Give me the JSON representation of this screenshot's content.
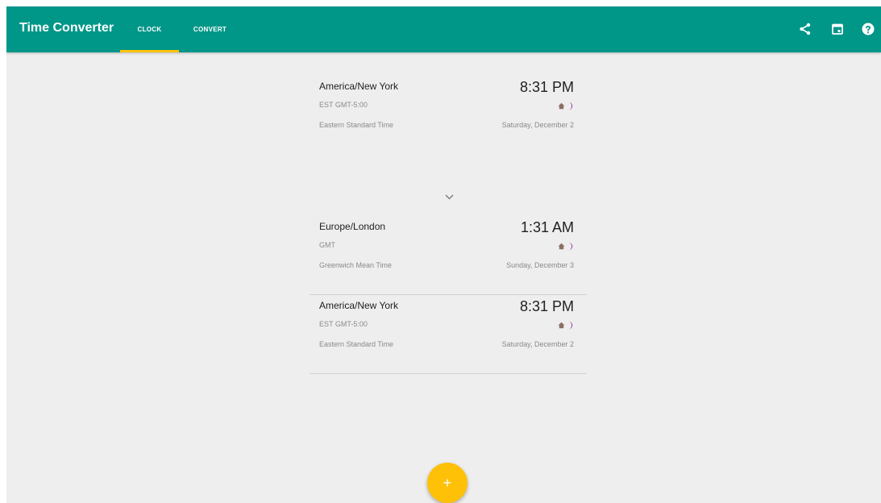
{
  "app": {
    "title": "Time Converter"
  },
  "tabs": [
    {
      "label": "CLOCK",
      "active": true
    },
    {
      "label": "CONVERT",
      "active": false
    }
  ],
  "actions": [
    {
      "icon": "share-icon"
    },
    {
      "icon": "calendar-icon"
    },
    {
      "icon": "help-icon"
    }
  ],
  "primary_clock": {
    "zone": "America/New York",
    "abbr": "EST GMT-5:00",
    "full_name": "Eastern Standard Time",
    "time": "8:31 PM",
    "date": "Saturday, December 2",
    "home_icon": "home-icon",
    "night_icon": "moon-icon"
  },
  "clocks": [
    {
      "zone": "Europe/London",
      "abbr": "GMT",
      "full_name": "Greenwich Mean Time",
      "time": "1:31 AM",
      "date": "Sunday, December 3",
      "home_icon": "home-icon",
      "night_icon": "moon-icon"
    },
    {
      "zone": "America/New York",
      "abbr": "EST GMT-5:00",
      "full_name": "Eastern Standard Time",
      "time": "8:31 PM",
      "date": "Saturday, December 2",
      "home_icon": "home-icon",
      "night_icon": "moon-icon"
    }
  ],
  "expand_icon": "chevron-down-icon",
  "fab": {
    "label": "+",
    "icon": "add-icon"
  },
  "colors": {
    "primary": "#009688",
    "accent": "#ffc107",
    "background": "#eeeeee",
    "home_icon": "#8d6e63",
    "moon_icon": "#9c27b0"
  }
}
